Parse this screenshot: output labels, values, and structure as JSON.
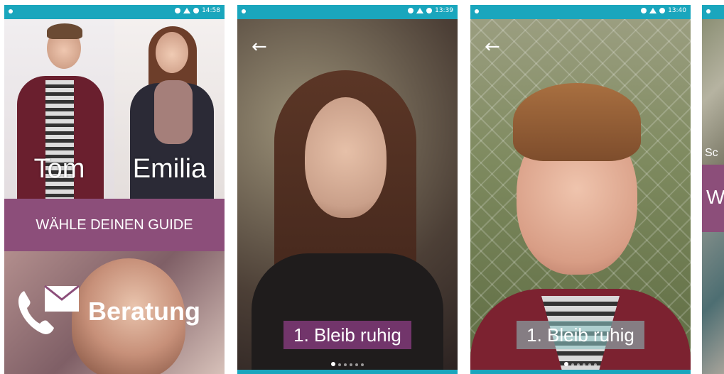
{
  "screens": [
    {
      "status_time": "14:58",
      "guides": [
        {
          "name": "Tom"
        },
        {
          "name": "Emilia"
        }
      ],
      "choose_guide_label": "WÄHLE DEINEN GUIDE",
      "beratung_label": "Beratung"
    },
    {
      "status_time": "13:39",
      "caption": "1. Bleib ruhig",
      "dots_total": 6,
      "dots_active": 1
    },
    {
      "status_time": "13:40",
      "caption": "1. Bleib ruhig",
      "dots_total": 6,
      "dots_active": 1
    },
    {
      "partial_text_1": "Sc",
      "partial_text_2": "W"
    }
  ],
  "colors": {
    "status_bar": "#1aa6bd",
    "accent_purple": "#8c4e7a"
  },
  "icons": {
    "back": "arrow-left-icon",
    "phone": "phone-icon",
    "mail": "mail-icon"
  }
}
